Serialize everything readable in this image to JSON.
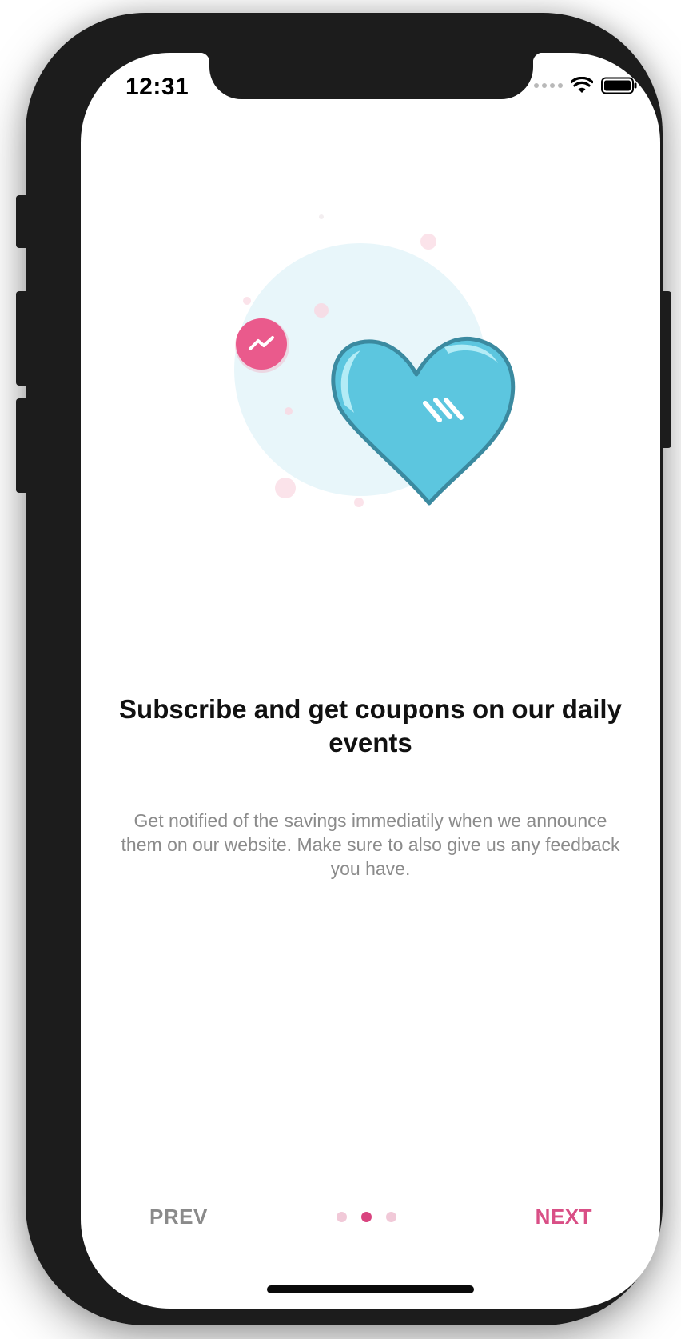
{
  "status_bar": {
    "time": "12:31"
  },
  "content": {
    "title": "Subscribe and get coupons on our daily events",
    "description": "Get notified of the savings immediatily when we announce them on our website. Make sure to also give us any feedback you have."
  },
  "navigation": {
    "prev_label": "PREV",
    "next_label": "NEXT",
    "pages": 3,
    "active_page": 2
  },
  "colors": {
    "accent": "#d9447f",
    "heart": "#5cc6df",
    "heart_outline": "#3b8aa0",
    "circle_bg": "#e8f6fa",
    "badge": "#ea5a8c"
  },
  "icons": {
    "badge": "messenger-icon",
    "wifi": "wifi-icon",
    "battery": "battery-icon"
  }
}
